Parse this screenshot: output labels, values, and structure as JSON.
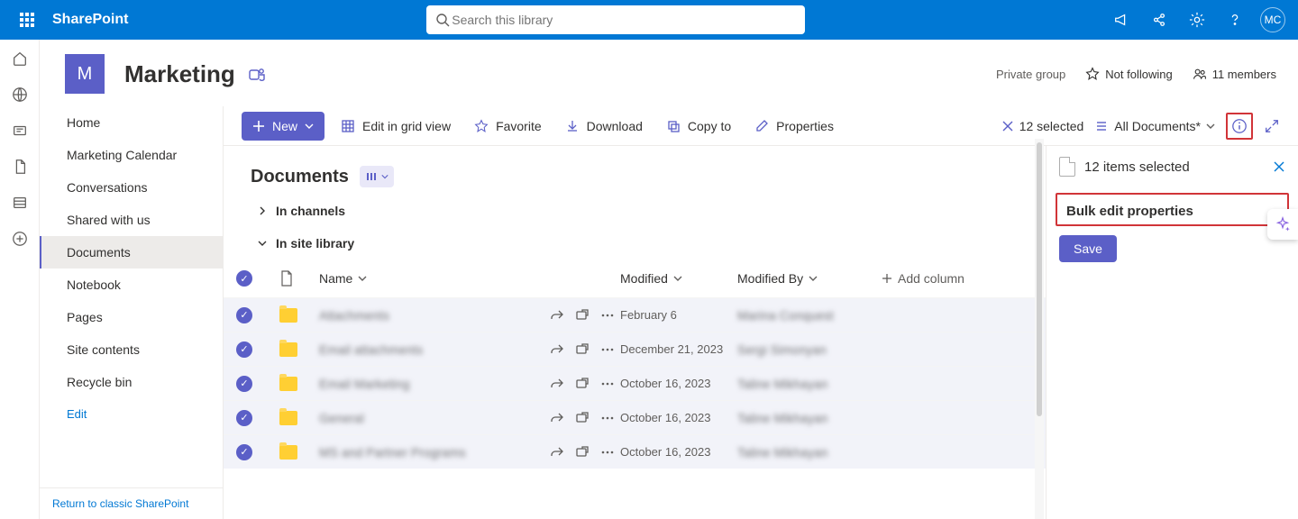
{
  "suite": {
    "title": "SharePoint",
    "search_placeholder": "Search this library",
    "avatar_initials": "MC"
  },
  "site": {
    "logo_letter": "M",
    "title": "Marketing",
    "privacy": "Private group",
    "follow_label": "Not following",
    "members_label": "11 members"
  },
  "nav": {
    "items": [
      {
        "label": "Home"
      },
      {
        "label": "Marketing Calendar"
      },
      {
        "label": "Conversations"
      },
      {
        "label": "Shared with us"
      },
      {
        "label": "Documents"
      },
      {
        "label": "Notebook"
      },
      {
        "label": "Pages"
      },
      {
        "label": "Site contents"
      },
      {
        "label": "Recycle bin"
      }
    ],
    "edit_label": "Edit",
    "classic_link": "Return to classic SharePoint"
  },
  "cmdbar": {
    "new_label": "New",
    "edit_grid": "Edit in grid view",
    "favorite": "Favorite",
    "download": "Download",
    "copy_to": "Copy to",
    "properties": "Properties",
    "selected_label": "12 selected",
    "view_label": "All Documents*"
  },
  "library": {
    "title": "Documents",
    "group_channels": "In channels",
    "group_site": "In site library",
    "columns": {
      "name": "Name",
      "modified": "Modified",
      "modified_by": "Modified By",
      "add_column": "Add column"
    },
    "rows": [
      {
        "name": "Attachments",
        "modified": "February 6",
        "by": "Marina Conquest"
      },
      {
        "name": "Email attachments",
        "modified": "December 21, 2023",
        "by": "Sergi Simonyan"
      },
      {
        "name": "Email Marketing",
        "modified": "October 16, 2023",
        "by": "Taline Mikhayan"
      },
      {
        "name": "General",
        "modified": "October 16, 2023",
        "by": "Taline Mikhayan"
      },
      {
        "name": "MS and Partner Programs",
        "modified": "October 16, 2023",
        "by": "Taline Mikhayan"
      }
    ]
  },
  "details": {
    "selected_title": "12 items selected",
    "bulk_title": "Bulk edit properties",
    "save_label": "Save"
  }
}
